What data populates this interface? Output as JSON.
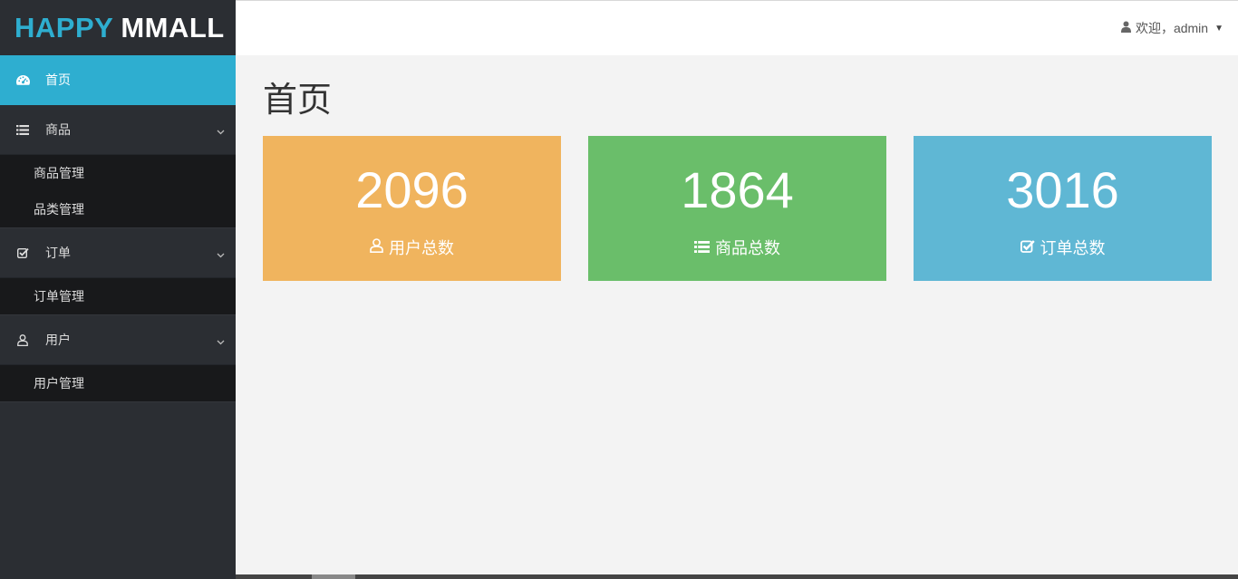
{
  "brand": {
    "part1": "HAPPY",
    "part2": "MMALL",
    "accent": "#2eaed0"
  },
  "header": {
    "welcome": "欢迎，admin",
    "user_icon": "user-icon",
    "caret_icon": "caret-down-icon"
  },
  "sidebar": {
    "items": [
      {
        "label": "首页",
        "icon": "dashboard-icon",
        "active": true
      },
      {
        "label": "商品",
        "icon": "list-icon",
        "children": [
          "商品管理",
          "品类管理"
        ]
      },
      {
        "label": "订单",
        "icon": "check-square-icon",
        "children": [
          "订单管理"
        ]
      },
      {
        "label": "用户",
        "icon": "user-outline-icon",
        "children": [
          "用户管理"
        ]
      }
    ]
  },
  "page": {
    "title": "首页"
  },
  "cards": [
    {
      "count": "2096",
      "label": "用户总数",
      "color": "#f0b45e",
      "icon": "user-outline-icon"
    },
    {
      "count": "1864",
      "label": "商品总数",
      "color": "#6abe6a",
      "icon": "list-icon"
    },
    {
      "count": "3016",
      "label": "订单总数",
      "color": "#5fb7d4",
      "icon": "check-square-icon"
    }
  ]
}
